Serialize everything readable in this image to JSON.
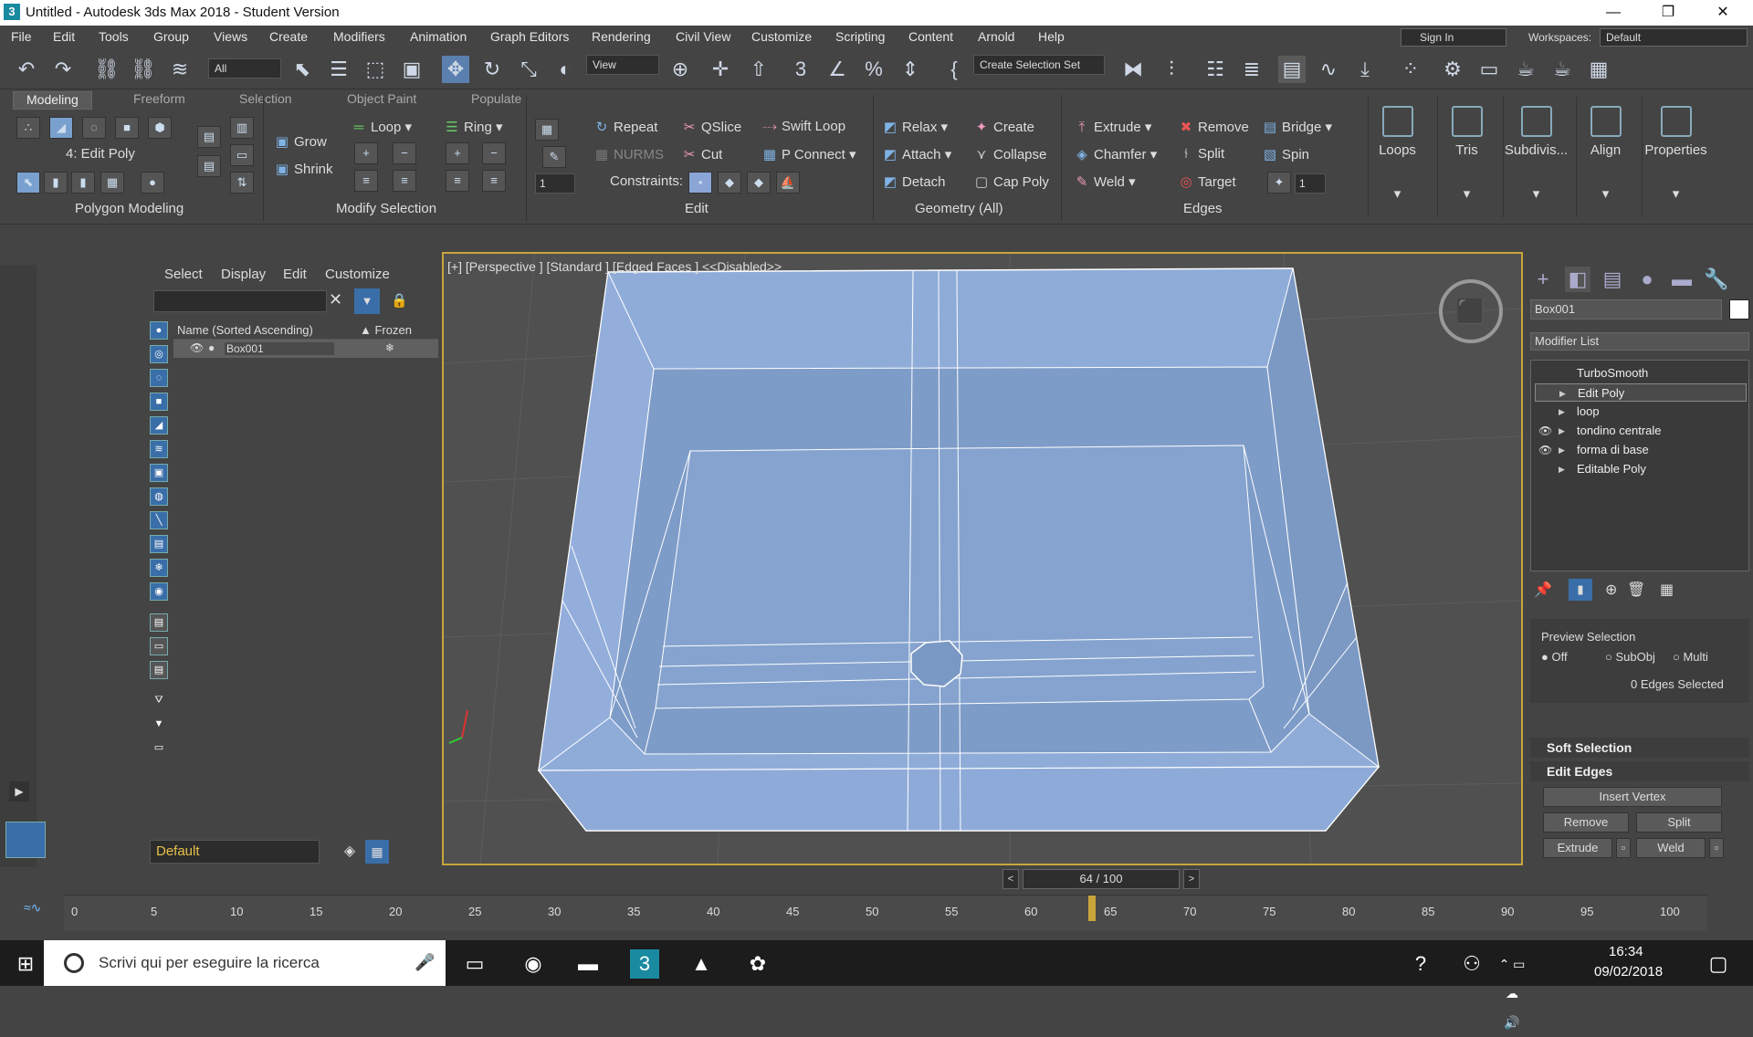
{
  "window": {
    "title": "Untitled - Autodesk 3ds Max 2018 - Student Version",
    "app_icon": "3"
  },
  "menu": [
    "File",
    "Edit",
    "Tools",
    "Group",
    "Views",
    "Create",
    "Modifiers",
    "Animation",
    "Graph Editors",
    "Rendering",
    "Civil View",
    "Customize",
    "Scripting",
    "Content",
    "Arnold",
    "Help"
  ],
  "account": {
    "sign_in": "Sign In",
    "workspaces_label": "Workspaces:",
    "workspace": "Default"
  },
  "toolbar": {
    "filter": "All",
    "ref_coord": "View",
    "selection_set": "Create Selection Set"
  },
  "ribbon": {
    "tabs": [
      "Modeling",
      "Freeform",
      "Selection",
      "Object Paint",
      "Populate"
    ],
    "level": "4: Edit Poly",
    "modify_sel": {
      "grow": "Grow",
      "shrink": "Shrink",
      "loop": "Loop",
      "ring": "Ring"
    },
    "edit": {
      "repeat": "Repeat",
      "qslice": "QSlice",
      "swift_loop": "Swift Loop",
      "nurms": "NURMS",
      "cut": "Cut",
      "p_connect": "P Connect",
      "constraints": "Constraints:",
      "spin_val": "1"
    },
    "geometry": {
      "relax": "Relax",
      "create": "Create",
      "attach": "Attach",
      "collapse": "Collapse",
      "detach": "Detach",
      "cap_poly": "Cap Poly"
    },
    "edges": {
      "extrude": "Extrude",
      "remove": "Remove",
      "bridge": "Bridge",
      "chamfer": "Chamfer",
      "split": "Split",
      "spin": "Spin",
      "weld": "Weld",
      "target": "Target",
      "target_val": "1"
    },
    "groups": [
      "Polygon Modeling",
      "Modify Selection",
      "Edit",
      "Geometry (All)",
      "Edges"
    ],
    "big": [
      "Loops",
      "Tris",
      "Subdivis...",
      "Align",
      "Properties"
    ]
  },
  "explorer": {
    "menu": [
      "Select",
      "Display",
      "Edit",
      "Customize"
    ],
    "col_name": "Name (Sorted Ascending)",
    "col_frozen": "▲ Frozen",
    "row": "Box001",
    "layer": "Default"
  },
  "viewport": {
    "label": "[+] [Perspective ] [Standard ] [Edged Faces ]  <<Disabled>>"
  },
  "command_panel": {
    "object_name": "Box001",
    "modifier_list": "Modifier List",
    "stack": [
      {
        "name": "TurboSmooth",
        "eye": false,
        "arrow": false,
        "selected": false
      },
      {
        "name": "Edit Poly",
        "eye": false,
        "arrow": true,
        "selected": true
      },
      {
        "name": "loop",
        "eye": false,
        "arrow": true,
        "selected": false
      },
      {
        "name": "tondino centrale",
        "eye": true,
        "arrow": true,
        "selected": false
      },
      {
        "name": "forma di base",
        "eye": true,
        "arrow": true,
        "selected": false
      },
      {
        "name": "Editable Poly",
        "eye": false,
        "arrow": true,
        "selected": false
      }
    ],
    "preview": {
      "title": "Preview Selection",
      "off": "Off",
      "subobj": "SubObj",
      "multi": "Multi",
      "status": "0 Edges Selected"
    },
    "soft_selection": "Soft Selection",
    "edit_edges": "Edit Edges",
    "buttons": {
      "insert_vertex": "Insert Vertex",
      "remove": "Remove",
      "split": "Split",
      "extrude": "Extrude",
      "weld": "Weld"
    }
  },
  "timeline": {
    "slider": "64 / 100",
    "current_frame": 64,
    "ticks": [
      "0",
      "5",
      "10",
      "15",
      "20",
      "25",
      "30",
      "35",
      "40",
      "45",
      "50",
      "55",
      "60",
      "65",
      "70",
      "75",
      "80",
      "85",
      "90",
      "95",
      "100"
    ]
  },
  "taskbar": {
    "search": "Scrivi qui per eseguire la ricerca",
    "time": "16:34",
    "date": "09/02/2018"
  }
}
